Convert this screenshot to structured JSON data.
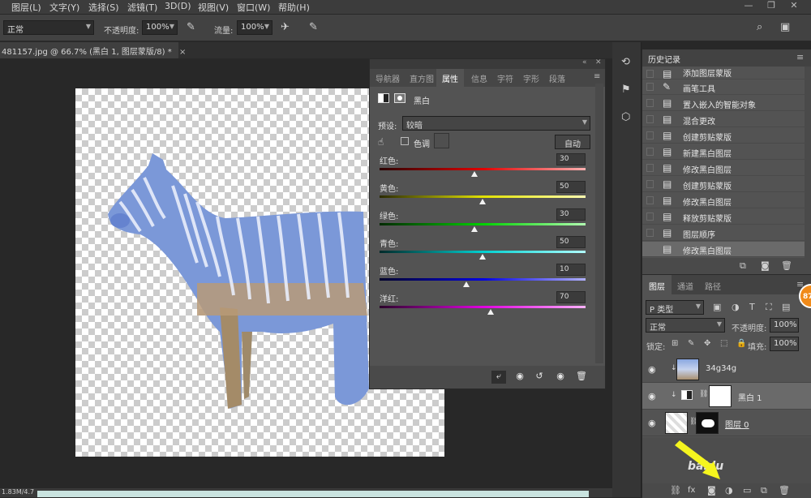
{
  "menubar": {
    "items": [
      "图层(L)",
      "文字(Y)",
      "选择(S)",
      "滤镜(T)",
      "3D(D)",
      "视图(V)",
      "窗口(W)",
      "帮助(H)"
    ],
    "window_controls": [
      "—",
      "❐",
      "✕"
    ]
  },
  "options": {
    "mode": "正常",
    "opacity_label": "不透明度:",
    "opacity_value": "100%",
    "flow_label": "流量:",
    "flow_value": "100%"
  },
  "document": {
    "tab_title": "481157.jpg @ 66.7% (黑白 1, 图层蒙版/8) *",
    "tab_close": "×",
    "status": "1.83M/4.7"
  },
  "properties": {
    "tabs": [
      "导航器",
      "直方图",
      "属性",
      "信息",
      "字符",
      "字形",
      "段落"
    ],
    "active_tab": "属性",
    "panel_title": "黑白",
    "preset_label": "预设:",
    "preset_value": "较暗",
    "tint_label": "色调",
    "auto_label": "自动",
    "sliders": [
      {
        "label": "红色:",
        "value": "30",
        "level": 0.46
      },
      {
        "label": "黄色:",
        "value": "50",
        "level": 0.5
      },
      {
        "label": "绿色:",
        "value": "30",
        "level": 0.46
      },
      {
        "label": "青色:",
        "value": "50",
        "level": 0.5
      },
      {
        "label": "蓝色:",
        "value": "10",
        "level": 0.42
      },
      {
        "label": "洋红:",
        "value": "70",
        "level": 0.54
      }
    ]
  },
  "history": {
    "title": "历史记录",
    "items": [
      {
        "icon": "layer-mask-icon",
        "label": "添加图层蒙版"
      },
      {
        "icon": "brush-icon",
        "label": "画笔工具"
      },
      {
        "icon": "document-icon",
        "label": "置入嵌入的智能对象"
      },
      {
        "icon": "document-icon",
        "label": "混合更改"
      },
      {
        "icon": "document-icon",
        "label": "创建剪贴蒙版"
      },
      {
        "icon": "document-icon",
        "label": "新建黑白图层"
      },
      {
        "icon": "document-icon",
        "label": "修改黑白图层"
      },
      {
        "icon": "document-icon",
        "label": "创建剪贴蒙版"
      },
      {
        "icon": "document-icon",
        "label": "修改黑白图层"
      },
      {
        "icon": "document-icon",
        "label": "释放剪贴蒙版"
      },
      {
        "icon": "document-icon",
        "label": "图层顺序"
      },
      {
        "icon": "document-icon",
        "label": "修改黑白图层"
      }
    ]
  },
  "layers": {
    "tabs": [
      "图层",
      "通道",
      "路径"
    ],
    "kind_label": "P 类型",
    "blend_mode": "正常",
    "opacity_label": "不透明度:",
    "opacity_value": "100%",
    "lock_label": "锁定:",
    "fill_label": "填充:",
    "fill_value": "100%",
    "items": [
      {
        "name": "34g34g"
      },
      {
        "name": "黑白 1"
      },
      {
        "name": "图层 0"
      }
    ],
    "watermark": "baidu"
  },
  "badge": "87",
  "colors": {
    "zebra_blue": "#6f8fd6",
    "arrow_yellow": "#f5f51e",
    "badge_orange": "#f08a19"
  }
}
